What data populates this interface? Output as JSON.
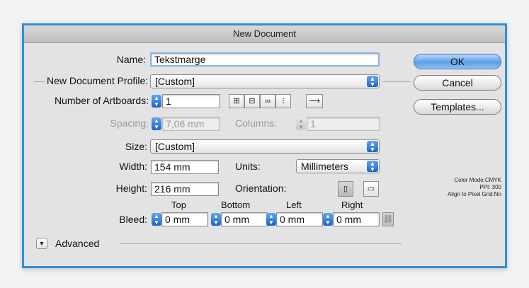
{
  "dialog": {
    "title": "New Document",
    "name_label": "Name:",
    "name_value": "Tekstmarge",
    "profile_label": "New Document Profile:",
    "profile_value": "[Custom]",
    "artboards_label": "Number of Artboards:",
    "artboards_value": "1",
    "arrange_icons": [
      "grid-by-row-icon",
      "grid-by-column-icon",
      "arrange-by-row-icon",
      "arrange-by-column-icon"
    ],
    "arrange_glyphs": [
      "⊞",
      "⊟",
      "∞",
      "⁝"
    ],
    "rtl_glyph": "⟶",
    "spacing_label": "Spacing:",
    "spacing_value": "7,06 mm",
    "columns_label": "Columns:",
    "columns_value": "1",
    "size_label": "Size:",
    "size_value": "[Custom]",
    "width_label": "Width:",
    "width_value": "154 mm",
    "units_label": "Units:",
    "units_value": "Millimeters",
    "height_label": "Height:",
    "height_value": "216 mm",
    "orientation_label": "Orientation:",
    "bleed_label": "Bleed:",
    "bleed_headers": [
      "Top",
      "Bottom",
      "Left",
      "Right"
    ],
    "bleed_values": [
      "0 mm",
      "0 mm",
      "0 mm",
      "0 mm"
    ],
    "advanced_label": "Advanced"
  },
  "buttons": {
    "ok": "OK",
    "cancel": "Cancel",
    "templates": "Templates..."
  },
  "info": {
    "color_mode": "Color Mode:CMYK",
    "ppi": "PPI: 300",
    "align": "Align to Pixel Grid:No"
  },
  "colors": {
    "frame_accent": "#2f8fd6",
    "stepper_blue": "#1f64c4"
  }
}
